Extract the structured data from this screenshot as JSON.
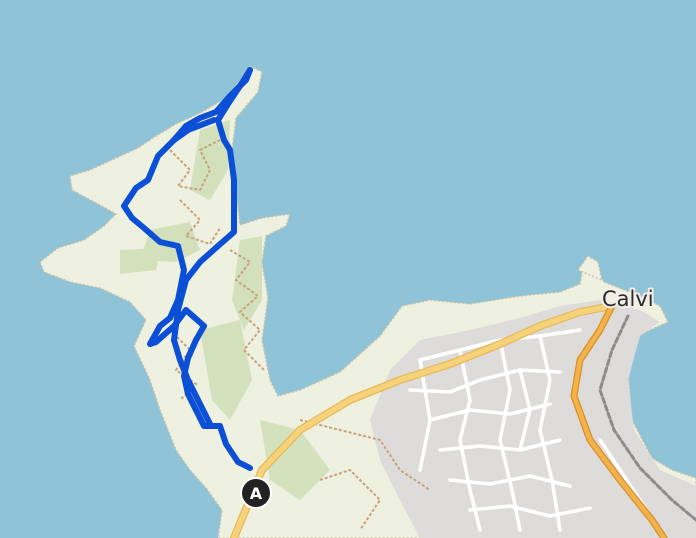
{
  "map": {
    "colors": {
      "sea": "#8fc3d8",
      "land": "#eef0e0",
      "shrub": "#c9dcb0",
      "town": "#dedcda",
      "route": "#0a4fd6",
      "main_road": "#f6d37a",
      "primary_road": "#f3b24a",
      "marker": "#222222"
    },
    "place_label": "Calvi",
    "start_marker": {
      "label": "A"
    }
  }
}
